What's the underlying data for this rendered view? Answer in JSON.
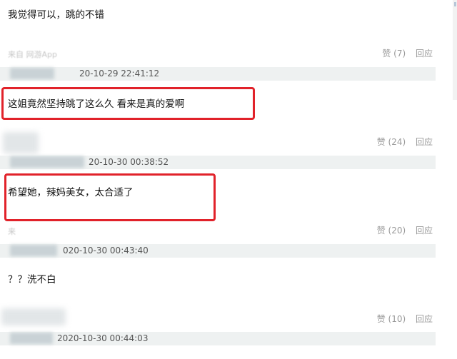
{
  "comments": [
    {
      "text": "我觉得可以，跳的不错",
      "source": "来自 网游App",
      "like_label": "赞 (7)",
      "reply_label": "回应",
      "time": "20-10-29 22:41:12"
    },
    {
      "text": "这姐竟然坚持跳了这么久 看来是真的爱啊",
      "source": "",
      "like_label": "赞 (24)",
      "reply_label": "回应",
      "time": "20-10-30 00:38:52"
    },
    {
      "text": "希望她，辣妈美女，太合适了",
      "source": "来",
      "like_label": "赞 (20)",
      "reply_label": "回应",
      "time": "020-10-30 00:43:40"
    },
    {
      "text": "？？洗不白",
      "source": "",
      "like_label": "赞 (10)",
      "reply_label": "回应",
      "time": "2020-10-30 00:44:03"
    }
  ],
  "colors": {
    "highlight": "#e1222a",
    "meta_bar": "#eef1f1",
    "muted_text": "#9a9a9a"
  }
}
